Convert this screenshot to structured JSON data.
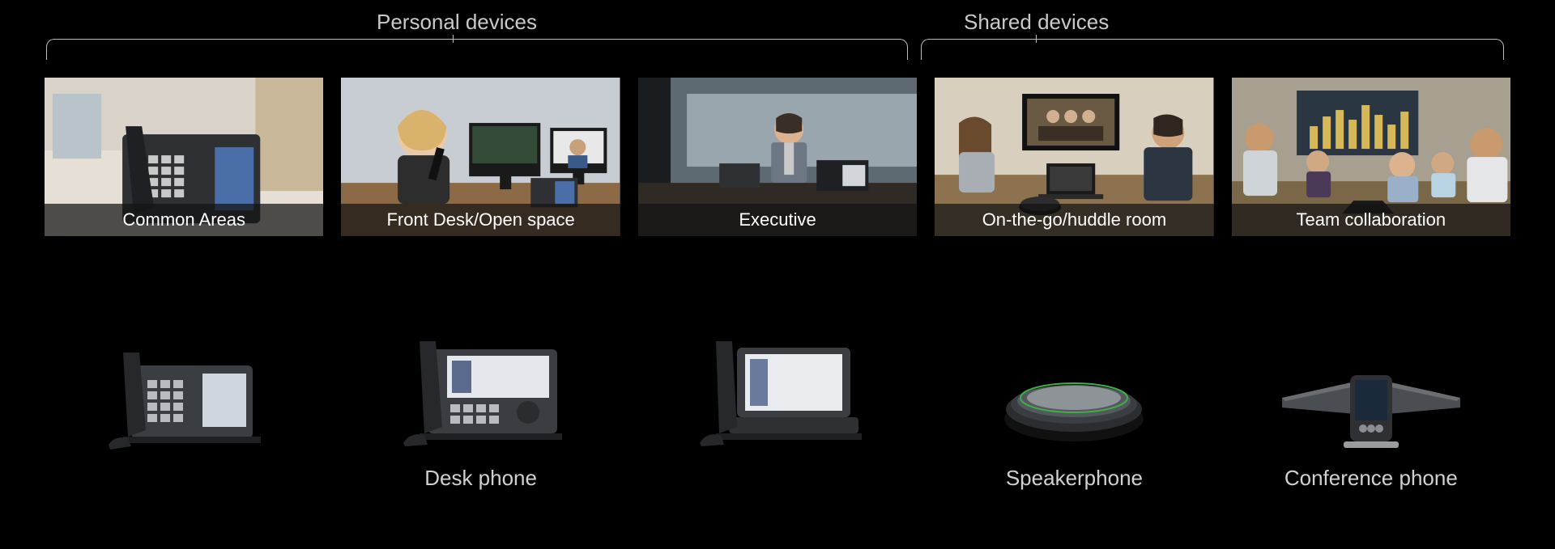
{
  "categories": {
    "personal": "Personal devices",
    "shared": "Shared devices"
  },
  "cards": [
    {
      "caption": "Common Areas"
    },
    {
      "caption": "Front Desk/Open space"
    },
    {
      "caption": "Executive"
    },
    {
      "caption": "On-the-go/huddle room"
    },
    {
      "caption": "Team collaboration"
    }
  ],
  "devices": [
    {
      "label": ""
    },
    {
      "label": "Desk phone"
    },
    {
      "label": ""
    },
    {
      "label": "Speakerphone"
    },
    {
      "label": "Conference phone"
    }
  ]
}
